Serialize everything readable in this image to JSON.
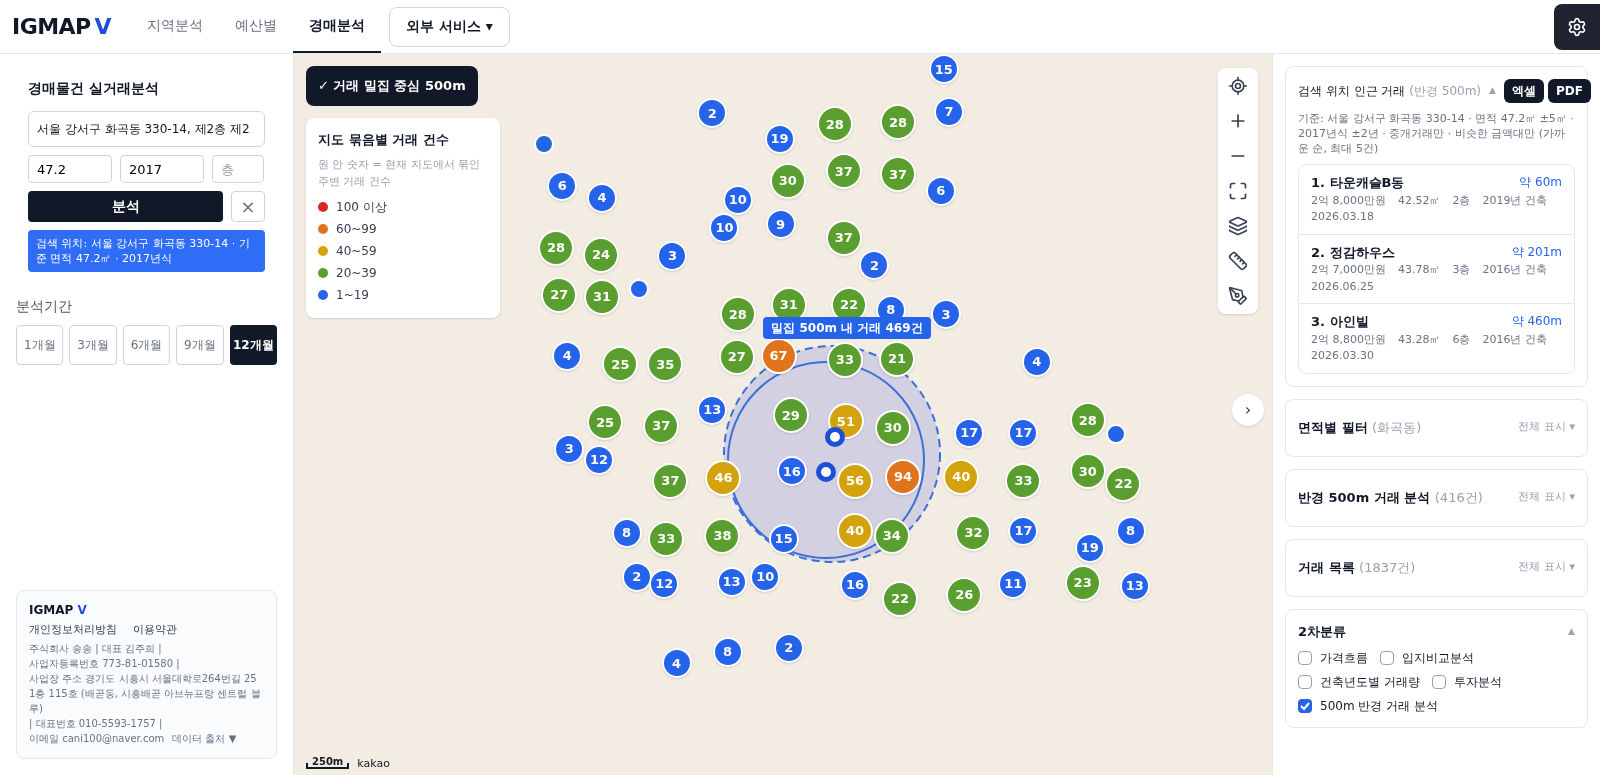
{
  "header": {
    "logo": "IGMAP",
    "logo_accent": "V",
    "tabs": [
      {
        "label": "지역분석",
        "selected": false
      },
      {
        "label": "예산별",
        "selected": false
      },
      {
        "label": "경매분석",
        "selected": true
      }
    ],
    "dropdown": {
      "label": "외부 서비스 ▾"
    }
  },
  "left": {
    "title": "경매물건 실거래분석",
    "address": "서울 강서구 화곡동 330-14, 제2층 제2",
    "area": "47.2",
    "year": "2017",
    "floor_placeholder": "층",
    "analyze": "분석",
    "clear": "×",
    "info": "검색 위치: 서울 강서구 화곡동 330-14 · 기준 면적 47.2㎡ · 2017년식",
    "period_label": "분석기간",
    "periods": [
      {
        "label": "1개월",
        "selected": false
      },
      {
        "label": "3개월",
        "selected": false
      },
      {
        "label": "6개월",
        "selected": false
      },
      {
        "label": "9개월",
        "selected": false
      },
      {
        "label": "12개월",
        "selected": true
      }
    ],
    "footer": {
      "brand": "IGMAP",
      "brand_accent": "V",
      "links": [
        "개인정보처리방침",
        "이용약관"
      ],
      "lines": [
        "주식회사 송송 | 대표 김주희 |",
        "사업자등록번호 773-81-01580 |",
        "사업장 주소 경기도 시흥시 서울대학로264번길 25 1층 115호 (배곧동, 시흥배곧 아브뉴프랑 센트럴 블루)",
        "| 대표번호 010-5593-1757 |"
      ],
      "email": "이메일 cani100@naver.com",
      "data_source": "데이터 출처 ▼"
    }
  },
  "map": {
    "toggle": "✓ 거래 밀집 중심 500m",
    "legend": {
      "title": "지도 묶음별 거래 건수",
      "note": "원 안 숫자 = 현재 지도에서 묶인 주변 거래 건수",
      "items": [
        {
          "label": "100 이상",
          "color": "#dc2626"
        },
        {
          "label": "60~99",
          "color": "#e0731c"
        },
        {
          "label": "40~59",
          "color": "#d4a20c"
        },
        {
          "label": "20~39",
          "color": "#5a9e2f"
        },
        {
          "label": "1~19",
          "color": "#2563eb"
        }
      ]
    },
    "density_tag": "밀집 500m 내 거래 469건",
    "scale": "250m",
    "attribution": "kakao",
    "collapse": "›",
    "clusters": [
      {
        "count": "15",
        "color": "#2563eb"
      },
      {
        "count": "2",
        "color": "#2563eb"
      },
      {
        "count": "19",
        "color": "#2563eb"
      },
      {
        "count": "28",
        "color": "#5a9e2f"
      },
      {
        "count": "28",
        "color": "#5a9e2f"
      },
      {
        "count": "7",
        "color": "#2563eb"
      },
      {
        "count": "6",
        "color": "#2563eb"
      },
      {
        "count": "4",
        "color": "#2563eb"
      },
      {
        "count": "30",
        "color": "#5a9e2f"
      },
      {
        "count": "37",
        "color": "#5a9e2f"
      },
      {
        "count": "37",
        "color": "#5a9e2f"
      },
      {
        "count": "6",
        "color": "#2563eb"
      },
      {
        "count": "10",
        "color": "#2563eb"
      },
      {
        "count": "10",
        "color": "#2563eb"
      },
      {
        "count": "9",
        "color": "#2563eb"
      },
      {
        "count": "28",
        "color": "#5a9e2f"
      },
      {
        "count": "24",
        "color": "#5a9e2f"
      },
      {
        "count": "3",
        "color": "#2563eb"
      },
      {
        "count": "37",
        "color": "#5a9e2f"
      },
      {
        "count": "2",
        "color": "#2563eb"
      },
      {
        "count": "27",
        "color": "#5a9e2f"
      },
      {
        "count": "31",
        "color": "#5a9e2f"
      },
      {
        "count": "31",
        "color": "#5a9e2f"
      },
      {
        "count": "22",
        "color": "#5a9e2f"
      },
      {
        "count": "8",
        "color": "#2563eb"
      },
      {
        "count": "28",
        "color": "#5a9e2f"
      },
      {
        "count": "3",
        "color": "#2563eb"
      },
      {
        "count": "4",
        "color": "#2563eb"
      },
      {
        "count": "25",
        "color": "#5a9e2f"
      },
      {
        "count": "35",
        "color": "#5a9e2f"
      },
      {
        "count": "27",
        "color": "#5a9e2f"
      },
      {
        "count": "67",
        "color": "#e0731c"
      },
      {
        "count": "33",
        "color": "#5a9e2f"
      },
      {
        "count": "21",
        "color": "#5a9e2f"
      },
      {
        "count": "4",
        "color": "#2563eb"
      },
      {
        "count": "13",
        "color": "#2563eb"
      },
      {
        "count": "29",
        "color": "#5a9e2f"
      },
      {
        "count": "51",
        "color": "#d4a20c"
      },
      {
        "count": "30",
        "color": "#5a9e2f"
      },
      {
        "count": "25",
        "color": "#5a9e2f"
      },
      {
        "count": "37",
        "color": "#5a9e2f"
      },
      {
        "count": "3",
        "color": "#2563eb"
      },
      {
        "count": "12",
        "color": "#2563eb"
      },
      {
        "count": "17",
        "color": "#2563eb"
      },
      {
        "count": "17",
        "color": "#2563eb"
      },
      {
        "count": "28",
        "color": "#5a9e2f"
      },
      {
        "count": "37",
        "color": "#5a9e2f"
      },
      {
        "count": "46",
        "color": "#d4a20c"
      },
      {
        "count": "16",
        "color": "#2563eb"
      },
      {
        "count": "56",
        "color": "#d4a20c"
      },
      {
        "count": "94",
        "color": "#e0731c"
      },
      {
        "count": "40",
        "color": "#d4a20c"
      },
      {
        "count": "33",
        "color": "#5a9e2f"
      },
      {
        "count": "30",
        "color": "#5a9e2f"
      },
      {
        "count": "22",
        "color": "#5a9e2f"
      },
      {
        "count": "8",
        "color": "#2563eb"
      },
      {
        "count": "33",
        "color": "#5a9e2f"
      },
      {
        "count": "38",
        "color": "#5a9e2f"
      },
      {
        "count": "15",
        "color": "#2563eb"
      },
      {
        "count": "40",
        "color": "#d4a20c"
      },
      {
        "count": "34",
        "color": "#5a9e2f"
      },
      {
        "count": "32",
        "color": "#5a9e2f"
      },
      {
        "count": "17",
        "color": "#2563eb"
      },
      {
        "count": "8",
        "color": "#2563eb"
      },
      {
        "count": "19",
        "color": "#2563eb"
      },
      {
        "count": "2",
        "color": "#2563eb"
      },
      {
        "count": "12",
        "color": "#2563eb"
      },
      {
        "count": "13",
        "color": "#2563eb"
      },
      {
        "count": "10",
        "color": "#2563eb"
      },
      {
        "count": "16",
        "color": "#2563eb"
      },
      {
        "count": "22",
        "color": "#5a9e2f"
      },
      {
        "count": "26",
        "color": "#5a9e2f"
      },
      {
        "count": "11",
        "color": "#2563eb"
      },
      {
        "count": "23",
        "color": "#5a9e2f"
      },
      {
        "count": "13",
        "color": "#2563eb"
      },
      {
        "count": "8",
        "color": "#2563eb"
      },
      {
        "count": "2",
        "color": "#2563eb"
      },
      {
        "count": "4",
        "color": "#2563eb"
      }
    ]
  },
  "right": {
    "nearby": {
      "title": "검색 위치 인근 거래",
      "subtitle": "(반경 500m)",
      "toggle": "▲",
      "buttons": [
        "엑셀",
        "PDF"
      ],
      "criteria": "기준: 서울 강서구 화곡동 330-14 · 면적 47.2㎡ ±5㎡ · 2017년식 ±2년 · 중개거래만 · 비슷한 금액대만 (가까운 순, 최대 5건)",
      "deals": [
        {
          "name": "1. 타운캐슬B동",
          "distance": "약 60m",
          "price": "2억 8,000만원",
          "area": "42.52㎡",
          "floor": "2층",
          "built": "2019년 건축",
          "date": "2026.03.18"
        },
        {
          "name": "2. 정감하우스",
          "distance": "약 201m",
          "price": "2억 7,000만원",
          "area": "43.78㎡",
          "floor": "3층",
          "built": "2016년 건축",
          "date": "2026.06.25"
        },
        {
          "name": "3. 아인빌",
          "distance": "약 460m",
          "price": "2억 8,800만원",
          "area": "43.28㎡",
          "floor": "6층",
          "built": "2016년 건축",
          "date": "2026.03.30"
        }
      ]
    },
    "sections": [
      {
        "title": "면적별 필터",
        "count": "(화곡동)",
        "action": "전체 표시 ▾"
      },
      {
        "title": "반경 500m 거래 분석",
        "count": "(416건)",
        "action": "전체 표시 ▾"
      },
      {
        "title": "거래 목록",
        "count": "(1837건)",
        "action": "전체 표시 ▾"
      }
    ],
    "secondary": {
      "title": "2차분류",
      "toggle": "▲",
      "options": [
        {
          "label": "가격흐름",
          "checked": false
        },
        {
          "label": "입지비교분석",
          "checked": false
        },
        {
          "label": "건축년도별 거래량",
          "checked": false
        },
        {
          "label": "투자분석",
          "checked": false
        },
        {
          "label": "500m 반경 거래 분석",
          "checked": true
        }
      ]
    }
  }
}
